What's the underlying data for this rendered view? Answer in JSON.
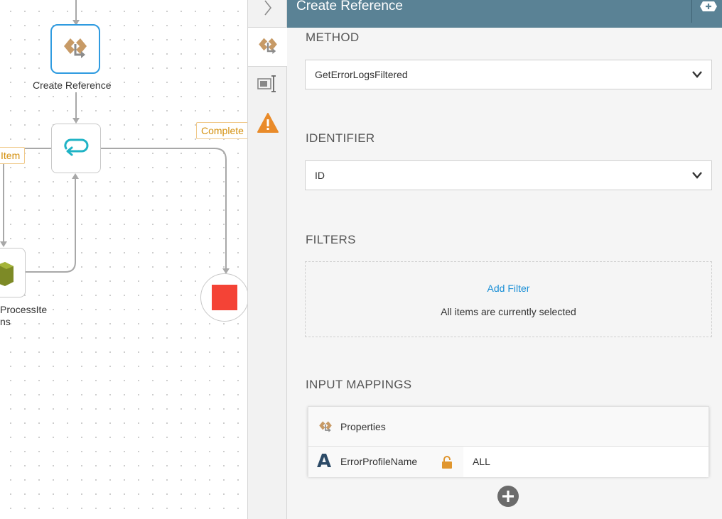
{
  "canvas": {
    "nodes": {
      "create_reference": {
        "label": "Create Reference"
      },
      "process_items": {
        "label_line1": "ProcessIte",
        "label_line2": "ns"
      }
    },
    "branch_tags": {
      "item": "Item",
      "complete": "Complete"
    }
  },
  "panel": {
    "title": "Create Reference",
    "method": {
      "label": "METHOD",
      "value": "GetErrorLogsFiltered"
    },
    "identifier": {
      "label": "IDENTIFIER",
      "value": "ID"
    },
    "filters": {
      "label": "FILTERS",
      "add_label": "Add Filter",
      "note": "All items are currently selected"
    },
    "input_mappings": {
      "label": "INPUT MAPPINGS",
      "group_label": "Properties",
      "rows": [
        {
          "name": "ErrorProfileName",
          "type": "A",
          "value": "ALL"
        }
      ]
    }
  },
  "colors": {
    "header": "#5a8295",
    "link": "#1a8fd6",
    "tag": "#d4900e",
    "selected": "#2f9be0",
    "stop": "#f44336",
    "warning": "#e98b2a"
  },
  "icons": [
    "chevron-right-icon",
    "reference-icon",
    "mapping-icon",
    "warning-icon",
    "loop-icon",
    "box-icon",
    "chevron-down-icon",
    "lock-icon",
    "plus-circle-icon",
    "collapse-panel-icon"
  ]
}
